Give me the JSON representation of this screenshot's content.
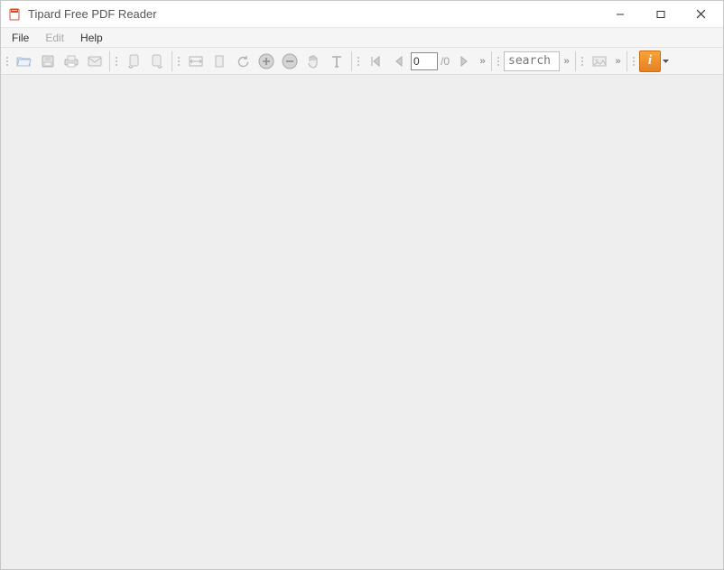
{
  "window": {
    "title": "Tipard Free PDF Reader"
  },
  "menu": {
    "file": "File",
    "edit": "Edit",
    "help": "Help"
  },
  "toolbar": {
    "page_current": "0",
    "page_total": "/0",
    "search_placeholder": "search"
  },
  "icons": {
    "open": "open-folder-icon",
    "save": "save-icon",
    "print": "print-icon",
    "mail": "mail-icon",
    "left_doc": "doc-arrow-left-icon",
    "right_doc": "doc-arrow-right-icon",
    "fit_width": "fit-width-icon",
    "fit_page": "fit-page-icon",
    "rotate": "rotate-icon",
    "zoom_in": "zoom-in-icon",
    "zoom_out": "zoom-out-icon",
    "hand": "hand-tool-icon",
    "text": "text-select-icon",
    "first": "first-page-icon",
    "prev": "prev-page-icon",
    "next": "next-page-icon",
    "image": "image-icon",
    "about": "about-icon"
  },
  "about_glyph": "i"
}
